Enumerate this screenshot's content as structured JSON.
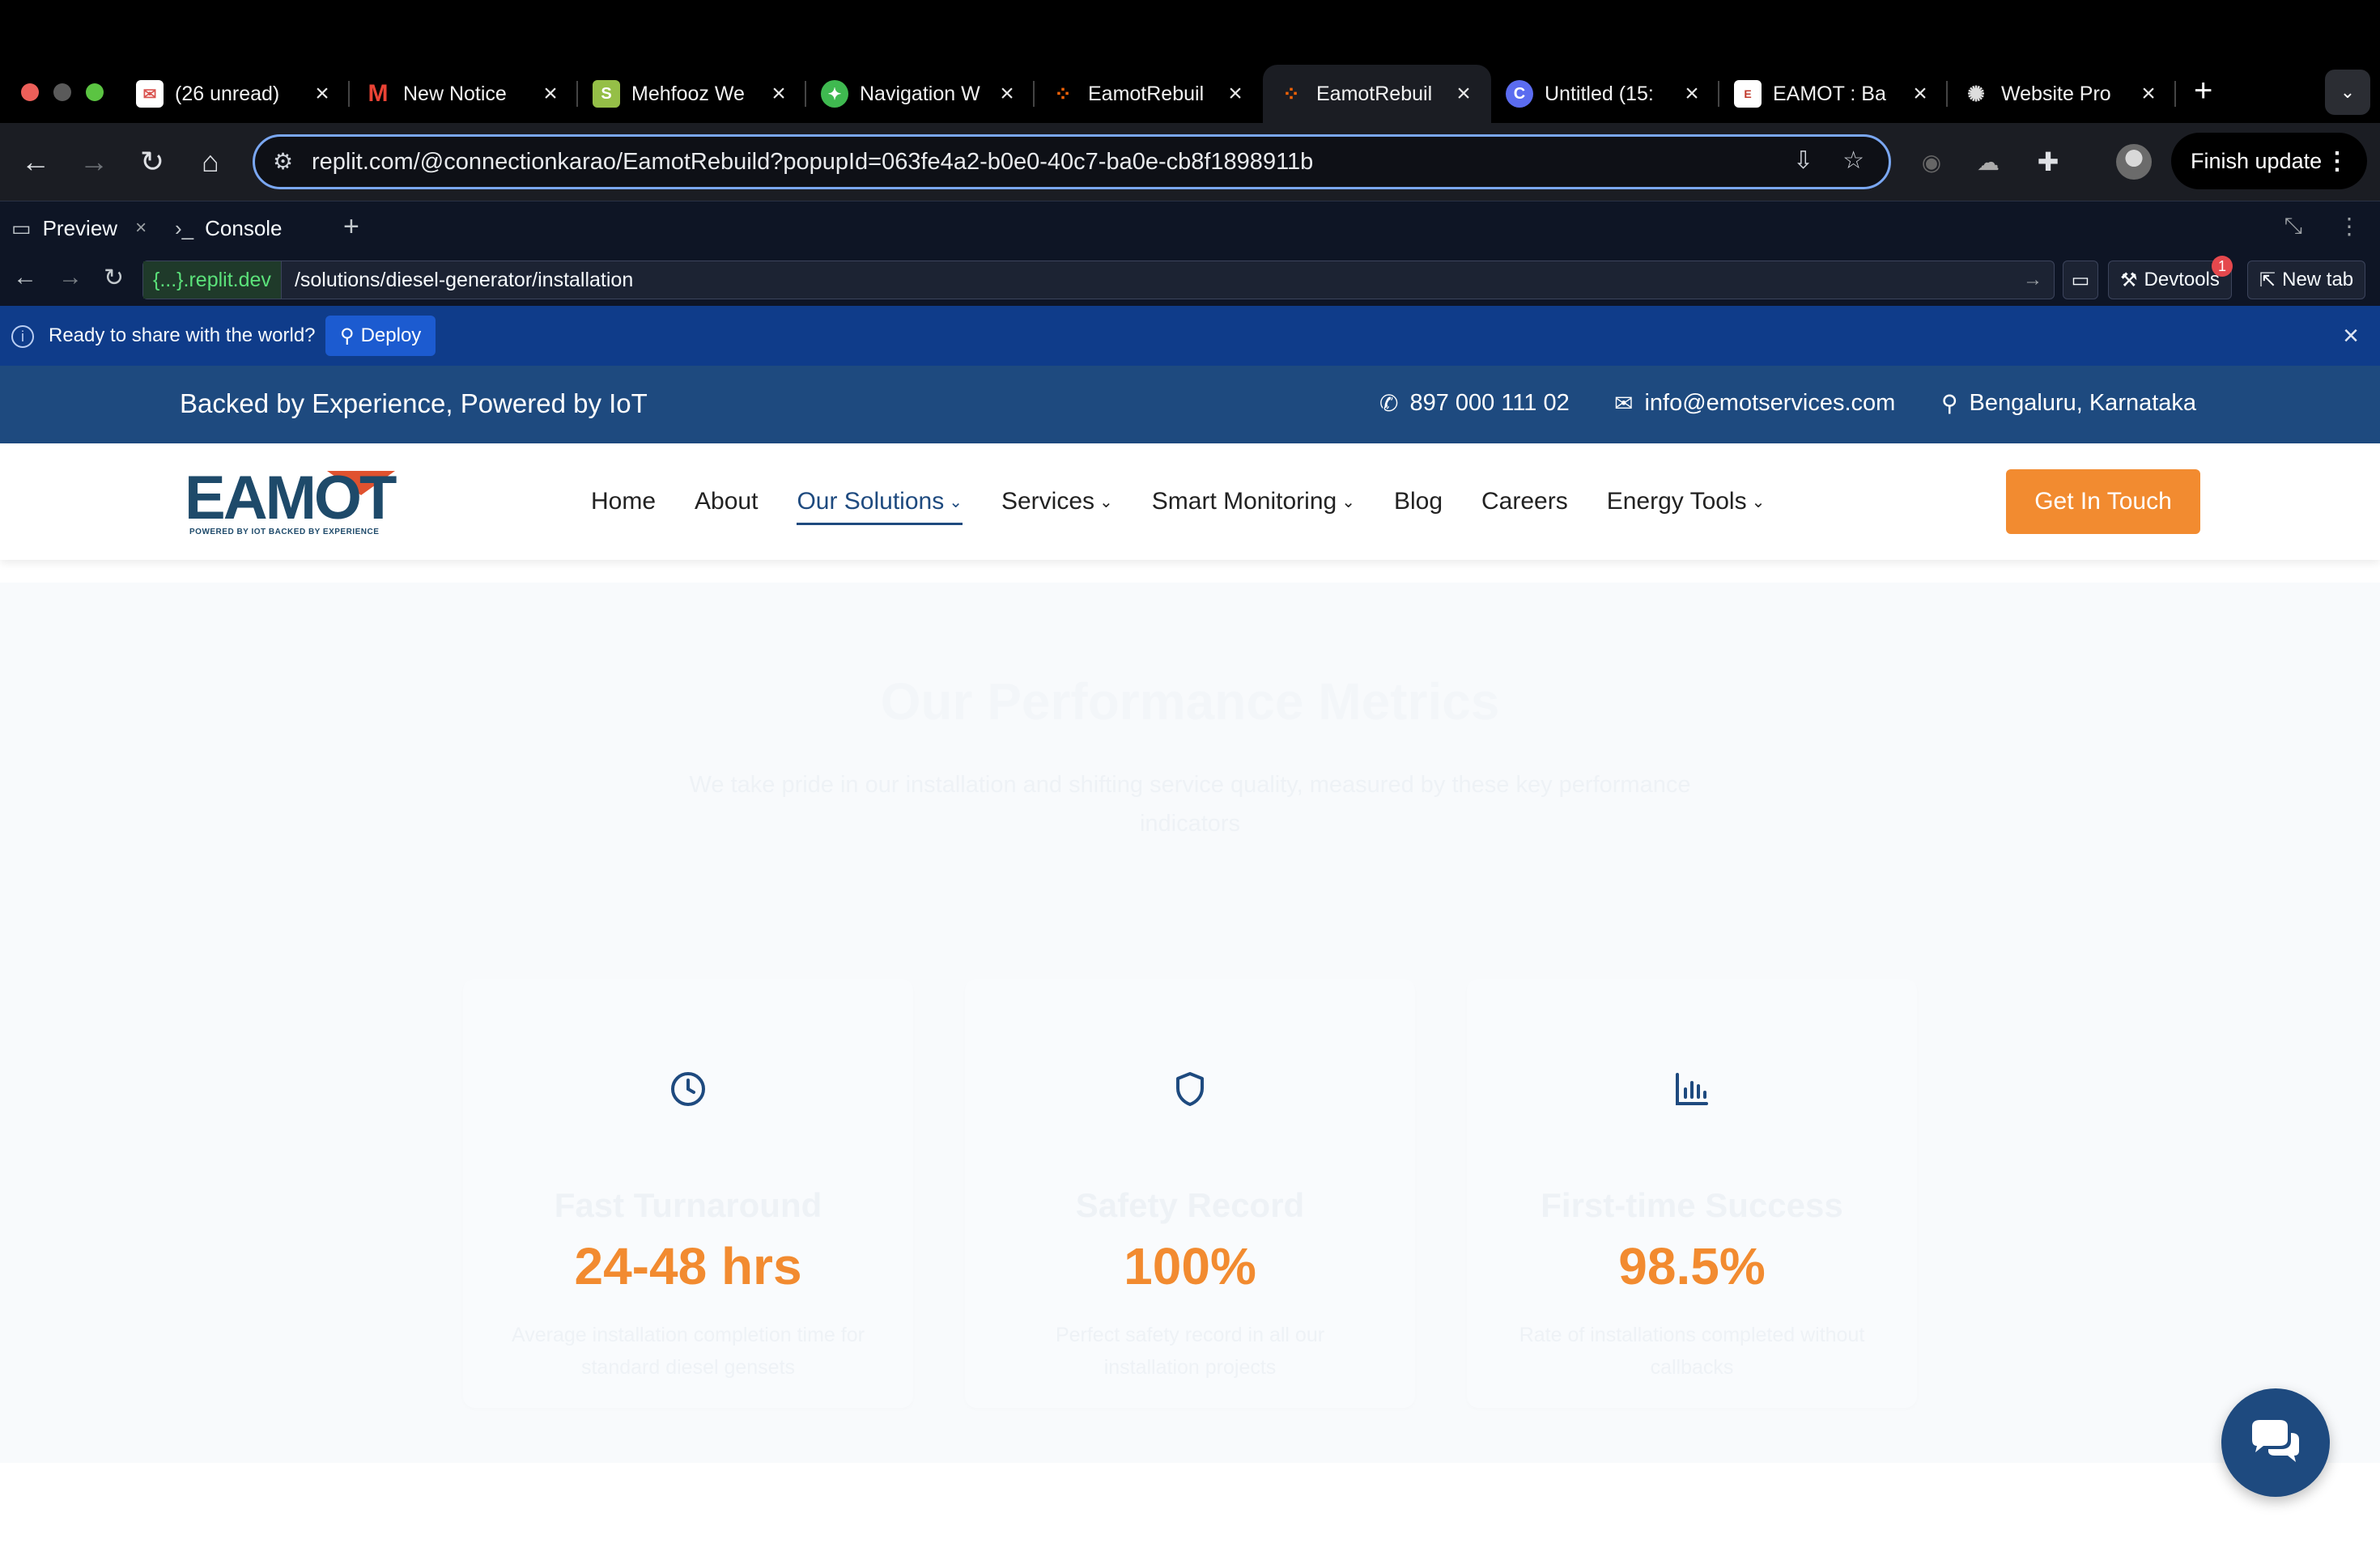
{
  "browser": {
    "tabs": [
      {
        "title": "(26 unread)",
        "favicon": "mail-cloud-icon",
        "active": false
      },
      {
        "title": "New Notice",
        "favicon": "gmail-icon",
        "active": false
      },
      {
        "title": "Mehfooz We",
        "favicon": "shopify-icon",
        "active": false
      },
      {
        "title": "Navigation W",
        "favicon": "replit-nav-icon",
        "active": false
      },
      {
        "title": "EamotRebuil",
        "favicon": "replit-icon",
        "active": false
      },
      {
        "title": "EamotRebuil",
        "favicon": "replit-icon",
        "active": true
      },
      {
        "title": "Untitled (15:",
        "favicon": "c-icon",
        "active": false
      },
      {
        "title": "EAMOT : Ba",
        "favicon": "eamot-icon",
        "active": false
      },
      {
        "title": "Website Pro",
        "favicon": "openai-icon",
        "active": false
      }
    ],
    "address": "replit.com/@connectionkarao/EamotRebuild?popupId=063fe4a2-b0e0-40c7-ba0e-cb8f1898911b",
    "finish_update": "Finish update"
  },
  "replit": {
    "tabs": [
      {
        "label": "Preview"
      },
      {
        "label": "Console"
      }
    ],
    "host": "{...}.replit.dev",
    "path": "/solutions/diesel-generator/installation",
    "devtools": "Devtools",
    "devtools_badge": "1",
    "new_tab": "New tab",
    "deploy_message": "Ready to share with the world?",
    "deploy_label": "Deploy"
  },
  "site": {
    "tagline": "Backed by Experience, Powered by IoT",
    "phone": "897 000 111 02",
    "email": "info@emotservices.com",
    "location": "Bengaluru, Karnataka",
    "logo_text": "EAMOT",
    "logo_tagline": "POWERED BY IOT BACKED BY EXPERIENCE",
    "nav": [
      {
        "label": "Home",
        "dropdown": false,
        "active": false
      },
      {
        "label": "About",
        "dropdown": false,
        "active": false
      },
      {
        "label": "Our Solutions",
        "dropdown": true,
        "active": true
      },
      {
        "label": "Services",
        "dropdown": true,
        "active": false
      },
      {
        "label": "Smart Monitoring",
        "dropdown": true,
        "active": false
      },
      {
        "label": "Blog",
        "dropdown": false,
        "active": false
      },
      {
        "label": "Careers",
        "dropdown": false,
        "active": false
      },
      {
        "label": "Energy Tools",
        "dropdown": true,
        "active": false
      }
    ],
    "cta": "Get In Touch",
    "metrics": {
      "heading": "Our Performance Metrics",
      "subheading": "We take pride in our installation and shifting service quality, measured by these key performance indicators",
      "cards": [
        {
          "icon": "clock-icon",
          "title": "Fast Turnaround",
          "value": "24-48 hrs",
          "description": "Average installation completion time for standard diesel gensets"
        },
        {
          "icon": "shield-icon",
          "title": "Safety Record",
          "value": "100%",
          "description": "Perfect safety record in all our installation projects"
        },
        {
          "icon": "bar-chart-icon",
          "title": "First-time Success",
          "value": "98.5%",
          "description": "Rate of installations completed without callbacks"
        }
      ]
    }
  },
  "colors": {
    "brand_blue": "#1e4a7f",
    "accent_orange": "#f28b30",
    "replit_bg": "#0e1525",
    "deploy_bar": "#0f3c8a"
  }
}
